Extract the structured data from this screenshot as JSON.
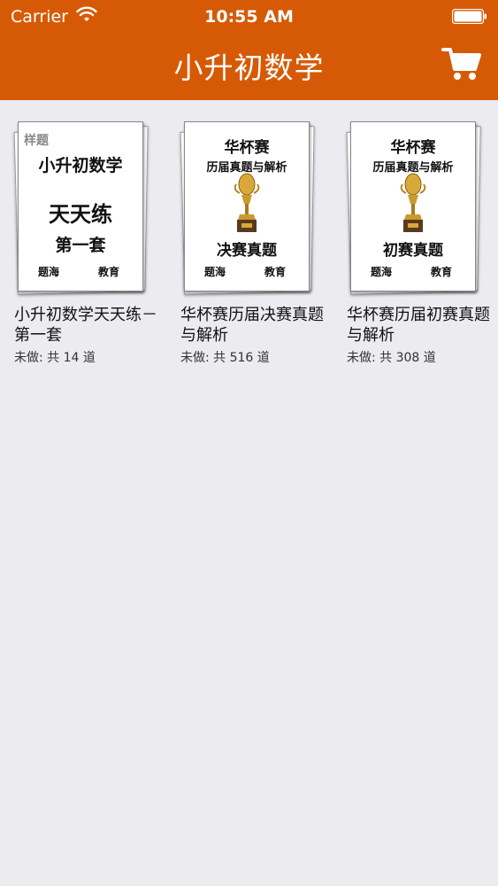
{
  "status_bar": {
    "carrier": "Carrier",
    "time": "10:55 AM",
    "wifi_icon": "wifi-icon",
    "battery_icon": "battery-icon"
  },
  "nav": {
    "title": "小升初数学",
    "cart_icon": "shopping-cart-icon"
  },
  "colors": {
    "nav_background": "#d65a05",
    "page_background": "#ebebf0"
  },
  "books": [
    {
      "cover": {
        "tag": "样题",
        "line1": "小升初数学",
        "line2": "天天练",
        "line3": "第一套",
        "publisher_left": "题海",
        "publisher_right": "教育"
      },
      "title": "小升初数学天天练－第一套",
      "count": "未做: 共 14 道"
    },
    {
      "cover": {
        "line1": "华杯赛",
        "line2": "历届真题与解析",
        "line3": "决赛真题",
        "publisher_left": "题海",
        "publisher_right": "教育",
        "image": "trophy-icon"
      },
      "title": "华杯赛历届决赛真题与解析",
      "count": "未做: 共 516 道"
    },
    {
      "cover": {
        "line1": "华杯赛",
        "line2": "历届真题与解析",
        "line3": "初赛真题",
        "publisher_left": "题海",
        "publisher_right": "教育",
        "image": "trophy-icon"
      },
      "title": "华杯赛历届初赛真题与解析",
      "count": "未做: 共 308 道"
    }
  ]
}
